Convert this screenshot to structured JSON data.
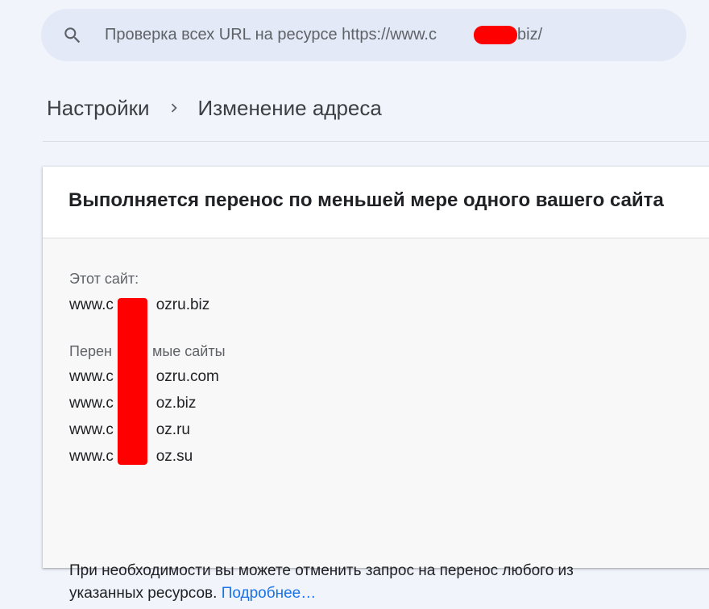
{
  "search": {
    "placeholder": "Проверка всех URL на ресурсе https://www.c      zru.biz/"
  },
  "breadcrumb": {
    "parent": "Настройки",
    "current": "Изменение адреса"
  },
  "card": {
    "title": "Выполняется перенос по меньшей мере одного вашего сайта",
    "this_site_label": "Этот сайт:",
    "this_site_value": "www.c     ozru.biz",
    "moving_sites_label": "Перен     мые сайты",
    "moving_sites": [
      "www.c     ozru.com",
      "www.c     oz.biz",
      "www.c     oz.ru",
      "www.c     oz.su"
    ],
    "note_text": "При необходимости вы можете отменить запрос на перенос любого из указанных ресурсов.",
    "learn_more": "Подробнее…"
  },
  "colors": {
    "background": "#f1f4fb",
    "search_bg": "#e3e9f6",
    "link": "#1a73e8",
    "redaction": "#ff0000"
  },
  "icons": {
    "search": "search-icon",
    "breadcrumb_separator": "chevron-right-icon"
  }
}
